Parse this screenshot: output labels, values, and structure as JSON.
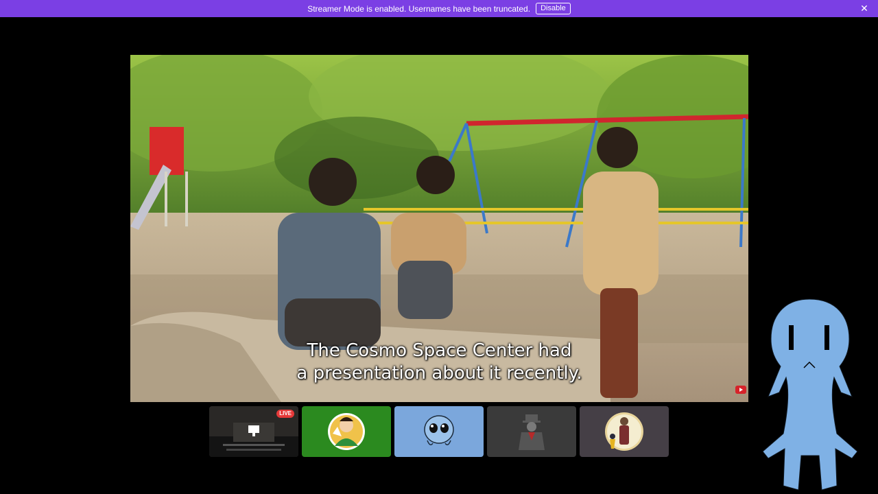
{
  "banner": {
    "message": "Streamer Mode is enabled. Usernames have been truncated.",
    "disable_label": "Disable",
    "close_icon": "close-icon",
    "color": "#7b3fe4"
  },
  "video": {
    "subtitle_line1": "The Cosmo Space Center had",
    "subtitle_line2": "a presentation about it recently.",
    "badge_icon": "youtube-icon"
  },
  "participants": [
    {
      "kind": "screen-share",
      "live_label": "LIVE",
      "bg": "#1f1f1f"
    },
    {
      "kind": "avatar",
      "bg": "#2b8a1f"
    },
    {
      "kind": "avatar",
      "bg": "#7ba7dc"
    },
    {
      "kind": "avatar",
      "bg": "#3a3a3a"
    },
    {
      "kind": "avatar",
      "bg": "#453f46"
    }
  ],
  "mascot": {
    "icon": "blue-alien-icon",
    "color": "#7fb1e5"
  }
}
